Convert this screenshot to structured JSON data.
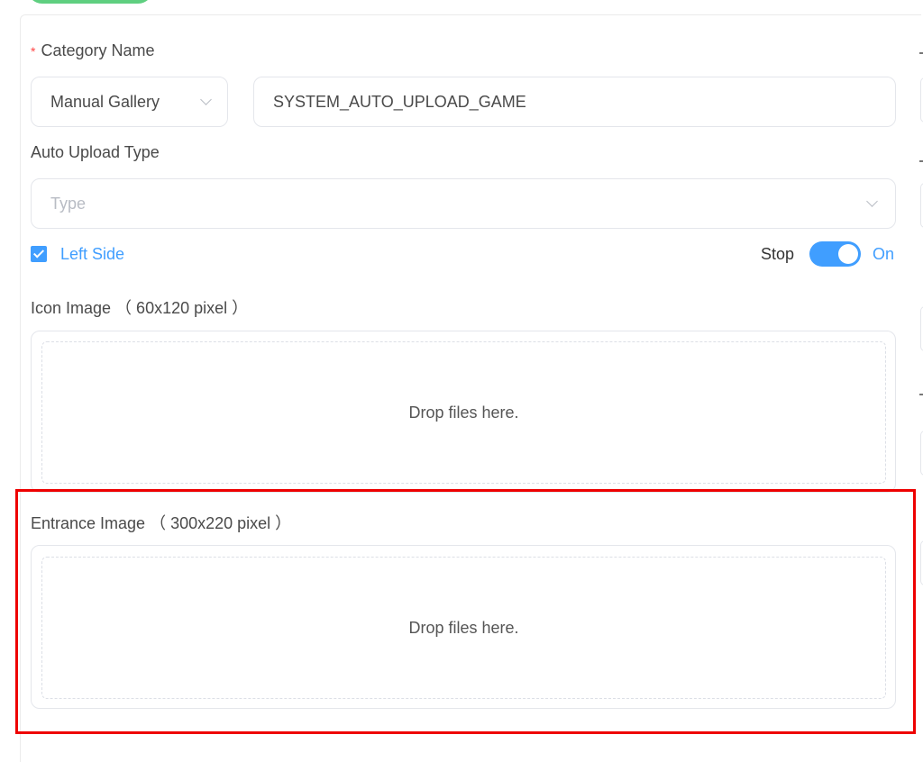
{
  "form": {
    "category_label": "Category Name",
    "required_mark": "*",
    "gallery_select": "Manual Gallery",
    "category_input": "SYSTEM_AUTO_UPLOAD_GAME",
    "auto_upload_label": "Auto Upload Type",
    "type_placeholder": "Type",
    "left_side_label": "Left Side",
    "left_side_checked": true,
    "stop_label": "Stop",
    "on_label": "On",
    "toggle_on": true,
    "icon_image_label": "Icon Image （ 60x120 pixel ）",
    "icon_drop": "Drop files here.",
    "entrance_image_label": "Entrance Image （ 300x220 pixel ）",
    "entrance_drop": "Drop files here."
  },
  "colors": {
    "accent": "#409eff",
    "highlight": "#e00000",
    "button": "#5fcf80"
  }
}
